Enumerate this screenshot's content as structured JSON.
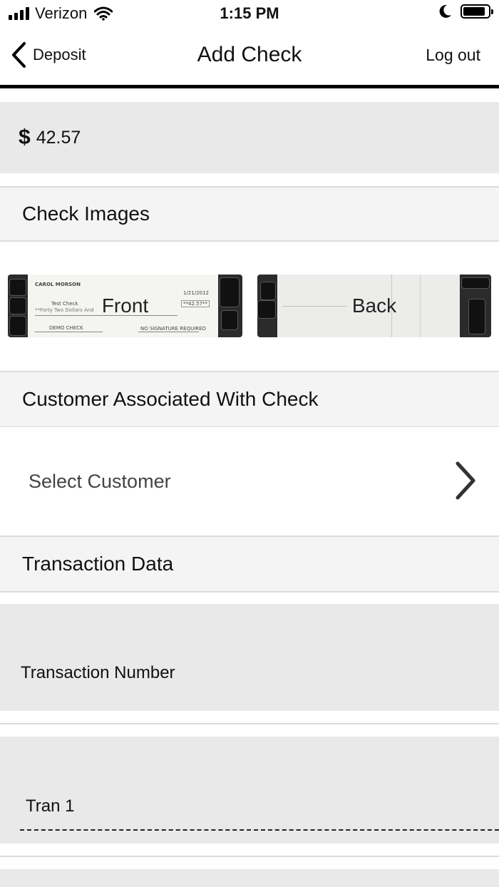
{
  "status_bar": {
    "carrier": "Verizon",
    "time": "1:15 PM"
  },
  "nav": {
    "back_label": "Deposit",
    "title": "Add Check",
    "logout_label": "Log out"
  },
  "amount": {
    "currency_symbol": "$",
    "value": "42.57"
  },
  "check_images": {
    "header": "Check Images",
    "front_label": "Front",
    "back_label": "Back",
    "front_check": {
      "name": "CAROL MORSON",
      "payee": "Test Check",
      "date": "1/21/2012",
      "amount": "**42.57**",
      "words": "**Forty Two Dollars And",
      "memo": "DEMO CHECK",
      "signature_note": "NO SIGNATURE REQUIRED"
    }
  },
  "customer": {
    "header": "Customer Associated With Check",
    "select_label": "Select Customer"
  },
  "transaction": {
    "header": "Transaction Data",
    "number_label": "Transaction Number",
    "field_value": "Tran 1"
  },
  "icons": [
    "signal-bars-icon",
    "wifi-icon",
    "moon-icon",
    "battery-icon",
    "chevron-left-icon",
    "chevron-right-icon"
  ]
}
